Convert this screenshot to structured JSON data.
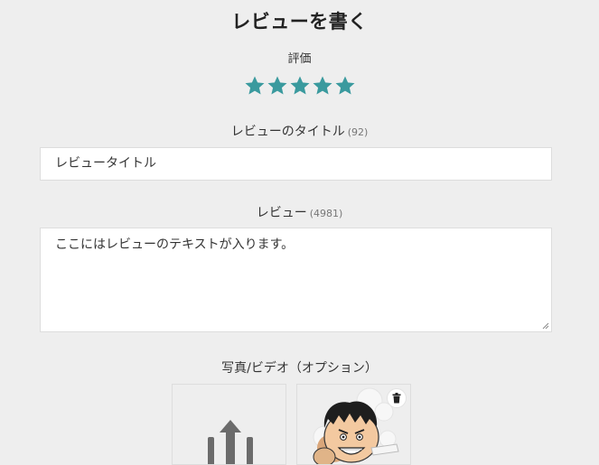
{
  "page": {
    "title": "レビューを書く"
  },
  "rating": {
    "label": "評価",
    "value": 5,
    "max": 5,
    "color": "#3a9a9e"
  },
  "review_title": {
    "label": "レビューのタイトル",
    "remaining": "(92)",
    "value": "レビュータイトル"
  },
  "review_body": {
    "label": "レビュー",
    "remaining": "(4981)",
    "value": "ここにはレビューのテキストが入ります。"
  },
  "media": {
    "label": "写真/ビデオ（オプション）",
    "upload_icon": "upload-icon",
    "delete_icon": "trash-icon"
  }
}
